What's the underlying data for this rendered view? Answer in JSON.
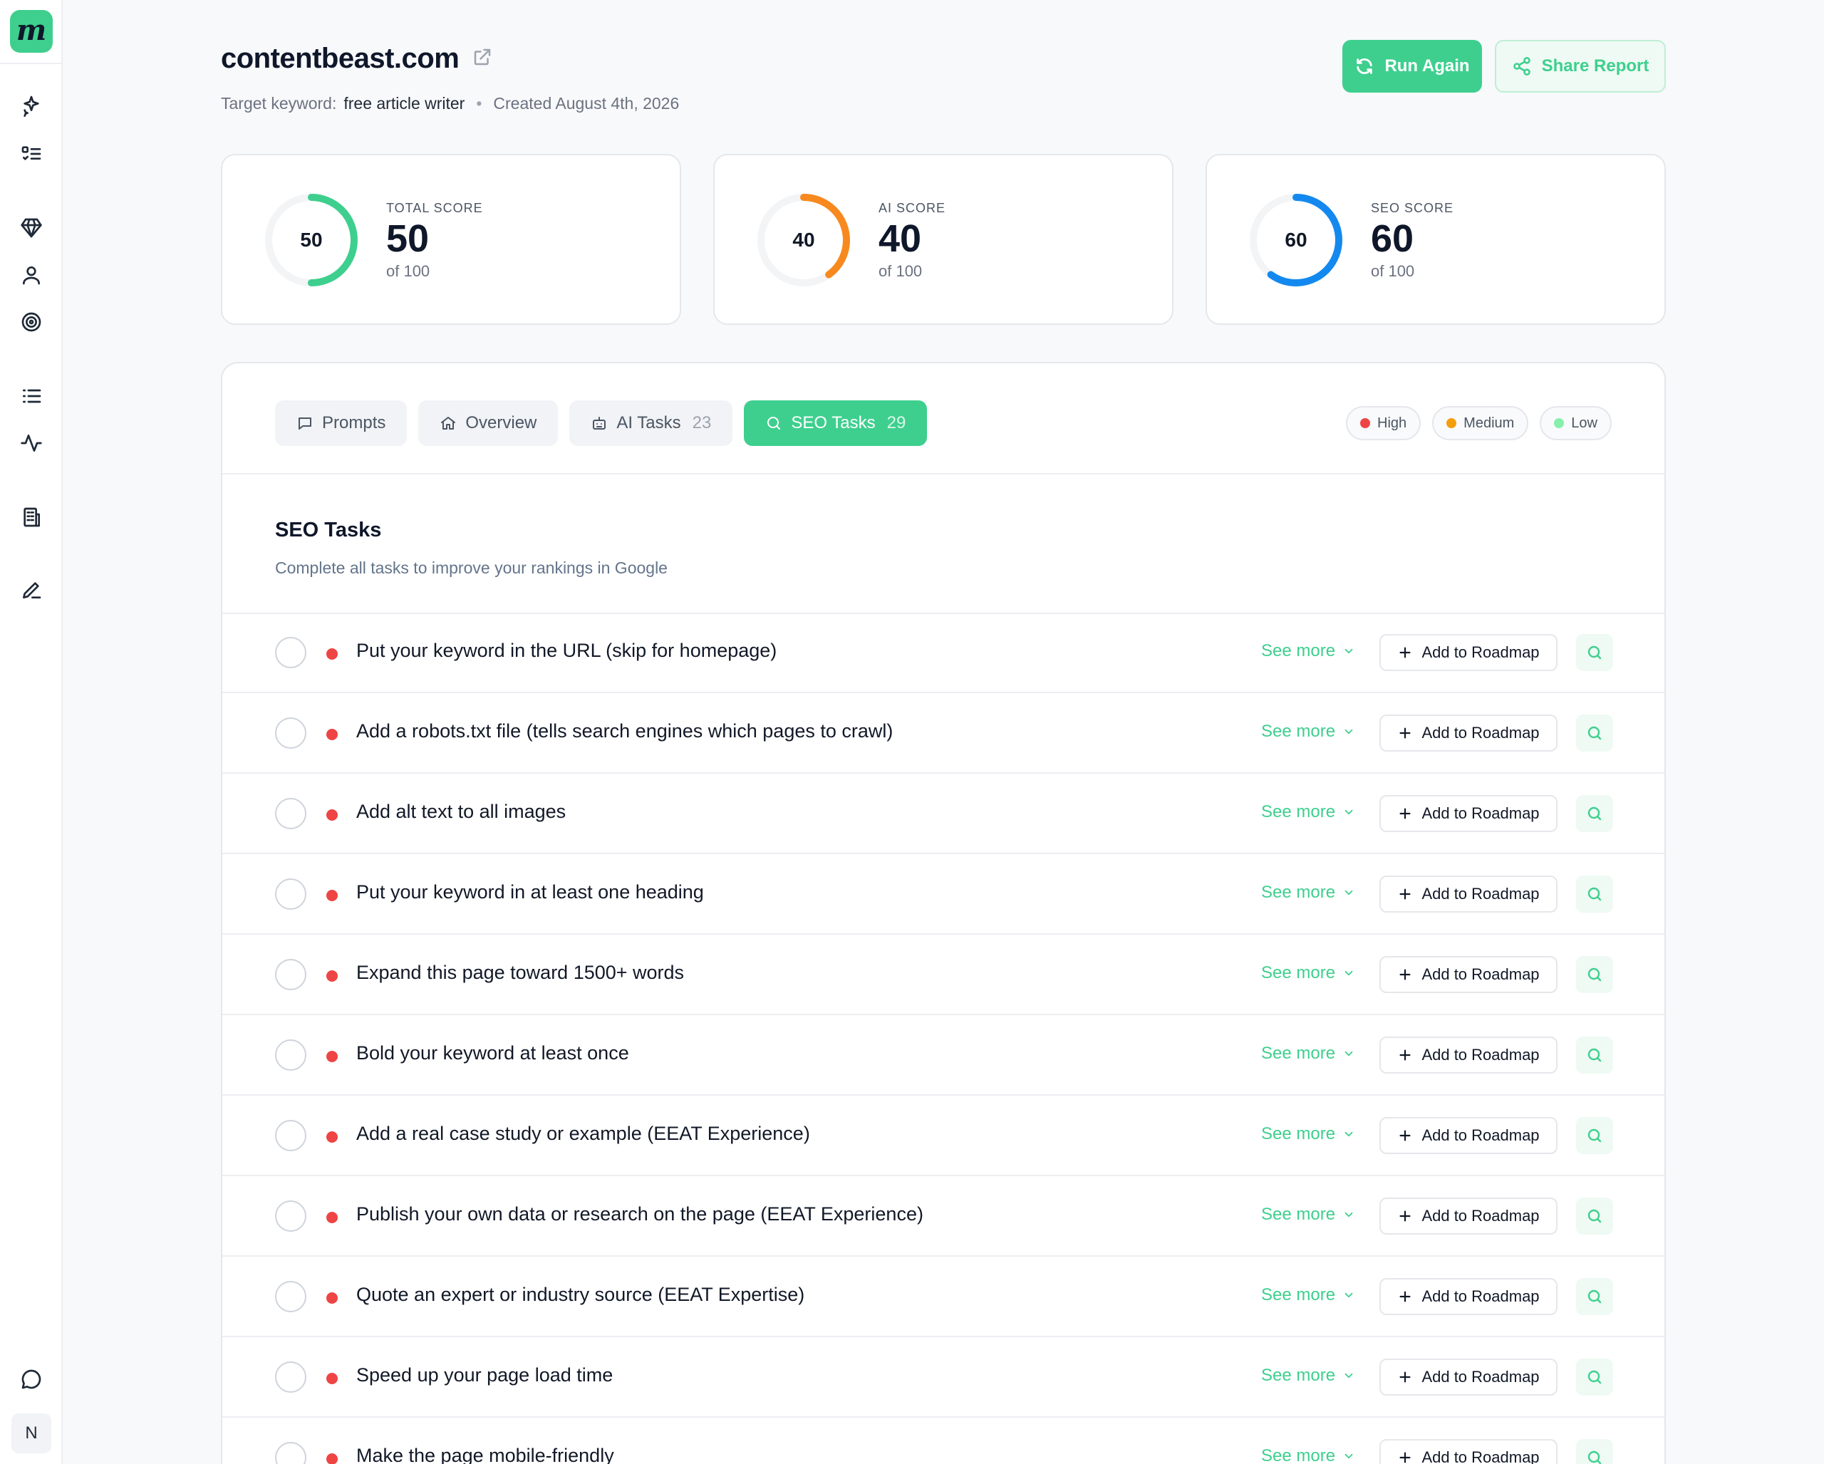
{
  "app": {
    "logo_letter": "m",
    "avatar_initial": "N"
  },
  "sidebar": {
    "icons": [
      "sparkles-icon",
      "checklist-icon",
      "diamond-icon",
      "user-icon",
      "target-icon",
      "list-icon",
      "activity-icon",
      "building-icon",
      "pen-icon",
      "chat-icon"
    ]
  },
  "header": {
    "title": "contentbeast.com",
    "keyword_label": "Target keyword:",
    "keyword": "free article writer",
    "separator": "•",
    "created": "Created August 4th, 2026",
    "run_again_label": "Run Again",
    "share_label": "Share Report"
  },
  "scores": [
    {
      "label": "TOTAL SCORE",
      "value": 50,
      "of": "of 100",
      "color": "#3ecf8e"
    },
    {
      "label": "AI SCORE",
      "value": 40,
      "of": "of 100",
      "color": "#f7891f"
    },
    {
      "label": "SEO SCORE",
      "value": 60,
      "of": "of 100",
      "color": "#1389f0"
    }
  ],
  "tabs": [
    {
      "label": "Prompts",
      "count": "",
      "icon": "message-icon",
      "active": false
    },
    {
      "label": "Overview",
      "count": "",
      "icon": "home-icon",
      "active": false
    },
    {
      "label": "AI Tasks",
      "count": "23",
      "icon": "robot-icon",
      "active": false
    },
    {
      "label": "SEO Tasks",
      "count": "29",
      "icon": "search-icon",
      "active": true
    }
  ],
  "legend": [
    {
      "label": "High",
      "color": "#ef4444"
    },
    {
      "label": "Medium",
      "color": "#f59e0b"
    },
    {
      "label": "Low",
      "color": "#86efac"
    }
  ],
  "section": {
    "title": "SEO Tasks",
    "subtitle": "Complete all tasks to improve your rankings in Google"
  },
  "row_actions": {
    "see_more": "See more",
    "add_to_roadmap": "Add to Roadmap"
  },
  "tasks": [
    {
      "text": "Put your keyword in the URL (skip for homepage)",
      "priority": "high"
    },
    {
      "text": "Add a robots.txt file (tells search engines which pages to crawl)",
      "priority": "high"
    },
    {
      "text": "Add alt text to all images",
      "priority": "high"
    },
    {
      "text": "Put your keyword in at least one heading",
      "priority": "high"
    },
    {
      "text": "Expand this page toward 1500+ words",
      "priority": "high"
    },
    {
      "text": "Bold your keyword at least once",
      "priority": "high"
    },
    {
      "text": "Add a real case study or example (EEAT Experience)",
      "priority": "high"
    },
    {
      "text": "Publish your own data or research on the page (EEAT Experience)",
      "priority": "high"
    },
    {
      "text": "Quote an expert or industry source (EEAT Expertise)",
      "priority": "high"
    },
    {
      "text": "Speed up your page load time",
      "priority": "high"
    },
    {
      "text": "Make the page mobile-friendly",
      "priority": "high"
    }
  ]
}
